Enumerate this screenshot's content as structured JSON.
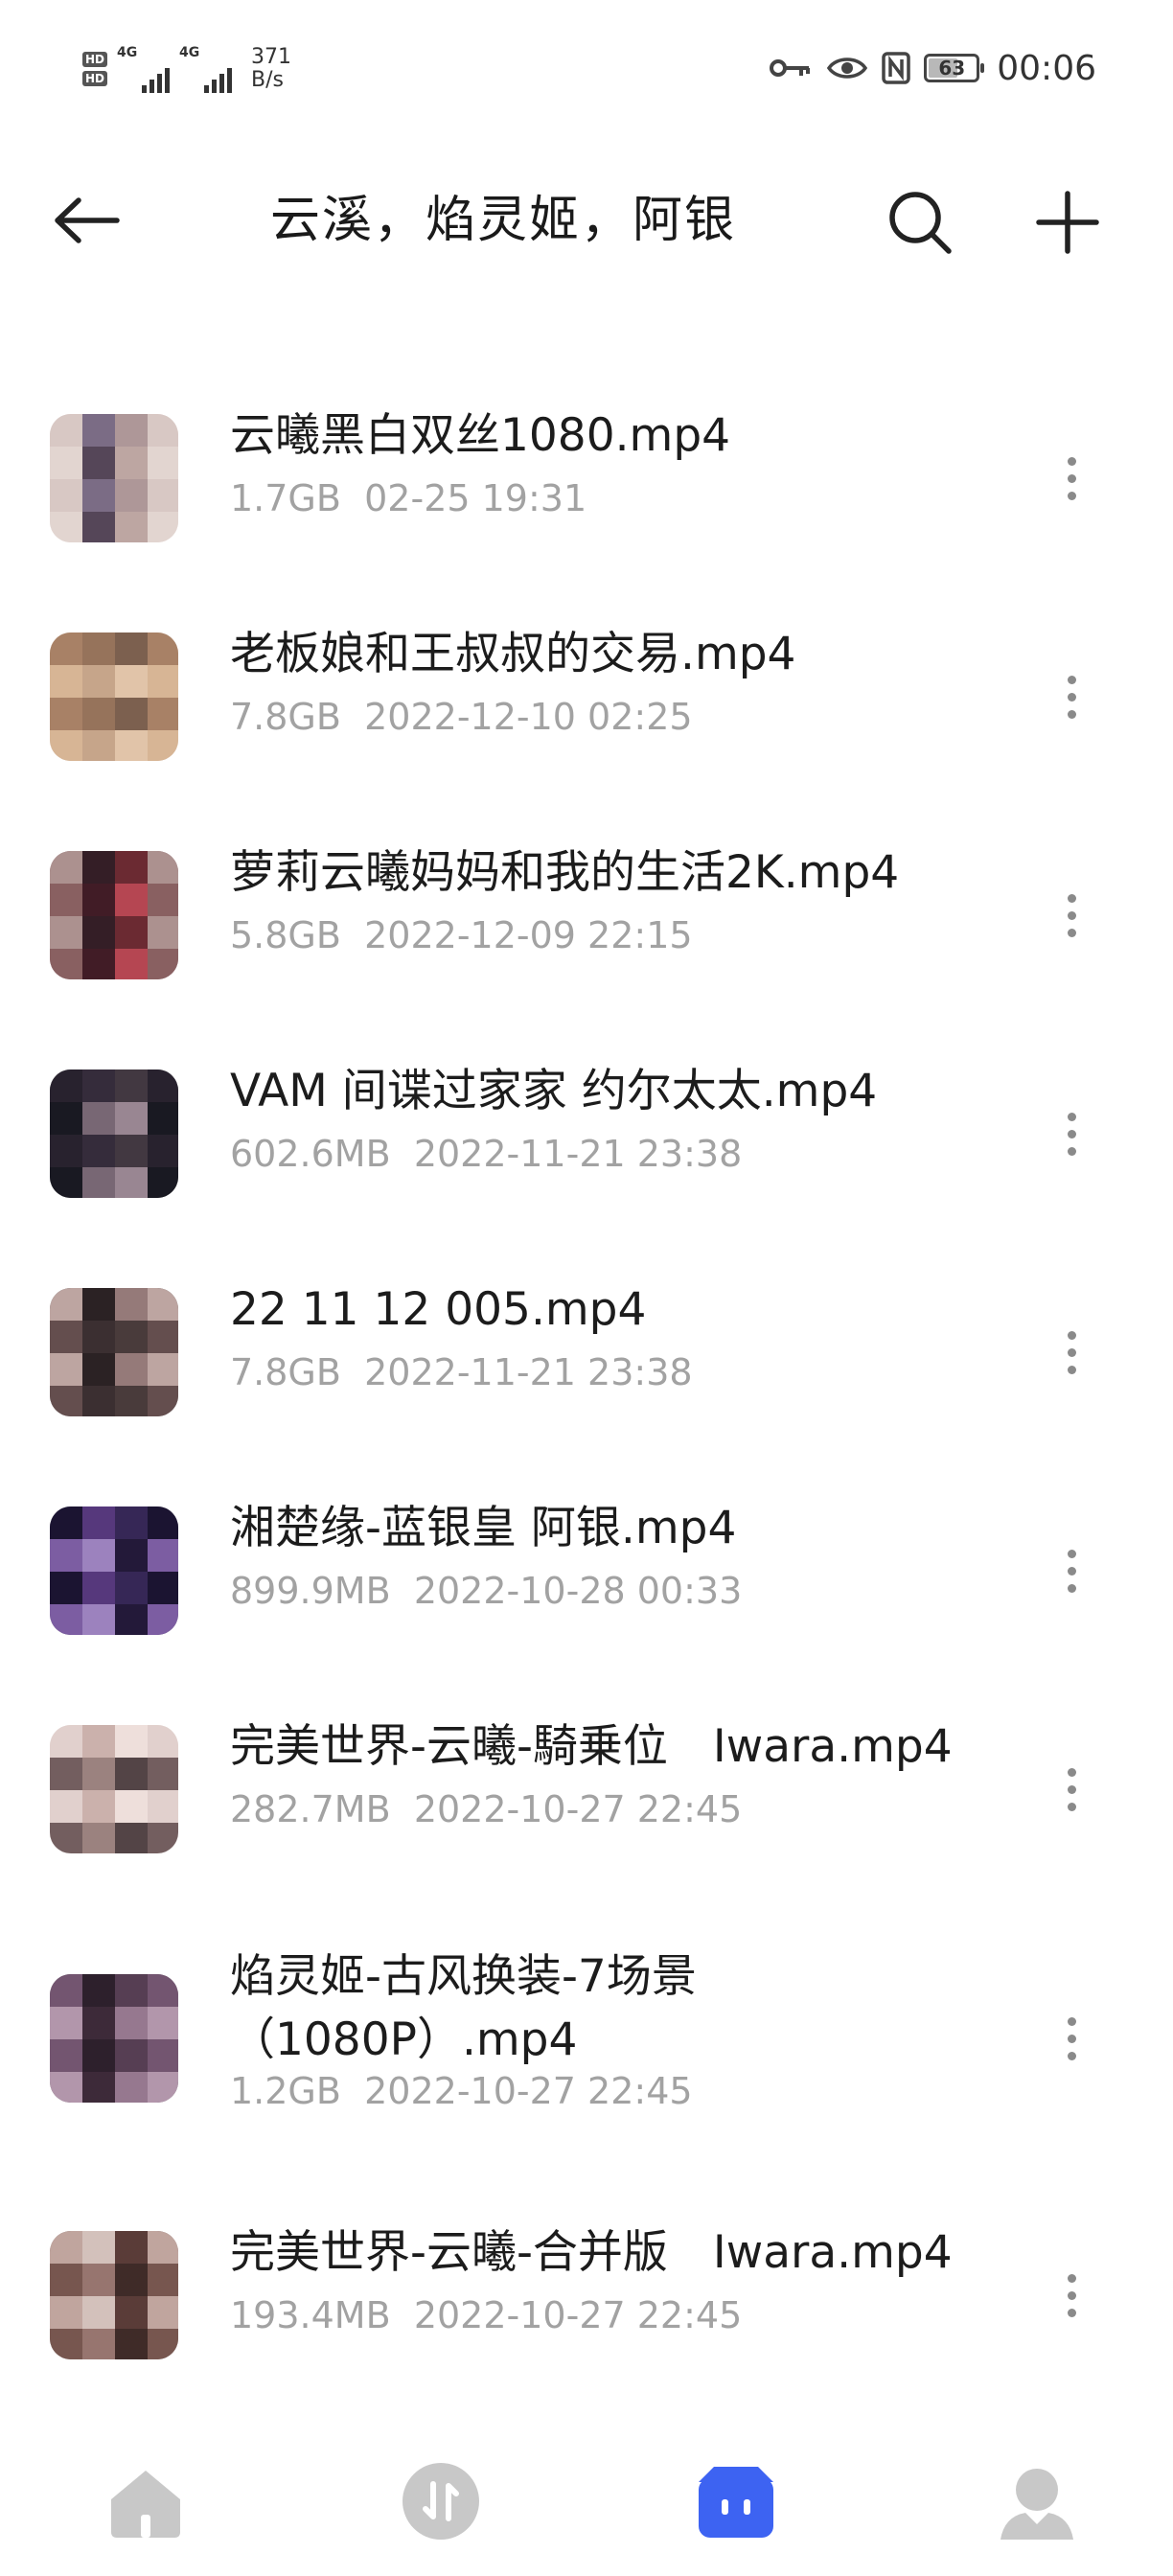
{
  "status_bar": {
    "signal_label_1": "4G",
    "signal_label_2": "4G",
    "hd_label": "HD",
    "net_speed_value": "371",
    "net_speed_unit": "B/s",
    "battery_level": "63",
    "clock": "00:06"
  },
  "header": {
    "title": "云溪，焰灵姬，阿银"
  },
  "files": [
    {
      "name": "云曦黑白双丝1080.mp4",
      "size": "1.7GB",
      "date": "02-25 19:31"
    },
    {
      "name": "老板娘和王叔叔的交易.mp4",
      "size": "7.8GB",
      "date": "2022-12-10 02:25"
    },
    {
      "name": "萝莉云曦妈妈和我的生活2K.mp4",
      "size": "5.8GB",
      "date": "2022-12-09 22:15"
    },
    {
      "name": "VAM 间谍过家家 约尔太太.mp4",
      "size": "602.6MB",
      "date": "2022-11-21 23:38"
    },
    {
      "name": "22 11 12 005.mp4",
      "size": "7.8GB",
      "date": "2022-11-21 23:38"
    },
    {
      "name": "湘楚缘-蓝银皇 阿银.mp4",
      "size": "899.9MB",
      "date": "2022-10-28 00:33"
    },
    {
      "name": "完美世界-云曦-騎乗位　Iwara.mp4",
      "size": "282.7MB",
      "date": "2022-10-27 22:45"
    },
    {
      "name": "焰灵姬-古风换装-7场景\n（1080P）.mp4",
      "size": "1.2GB",
      "date": "2022-10-27 22:45"
    },
    {
      "name": "完美世界-云曦-合并版　Iwara.mp4",
      "size": "193.4MB",
      "date": "2022-10-27 22:45"
    }
  ],
  "colors": {
    "accent": "#3d63f2",
    "nav_inactive": "#c8c8c8",
    "meta_text": "#a2a2a2"
  },
  "bottom_nav": [
    {
      "name": "home",
      "icon": "home-icon",
      "active": false
    },
    {
      "name": "transfer",
      "icon": "transfer-icon",
      "active": false
    },
    {
      "name": "files",
      "icon": "files-box-icon",
      "active": true
    },
    {
      "name": "profile",
      "icon": "person-icon",
      "active": false
    }
  ]
}
